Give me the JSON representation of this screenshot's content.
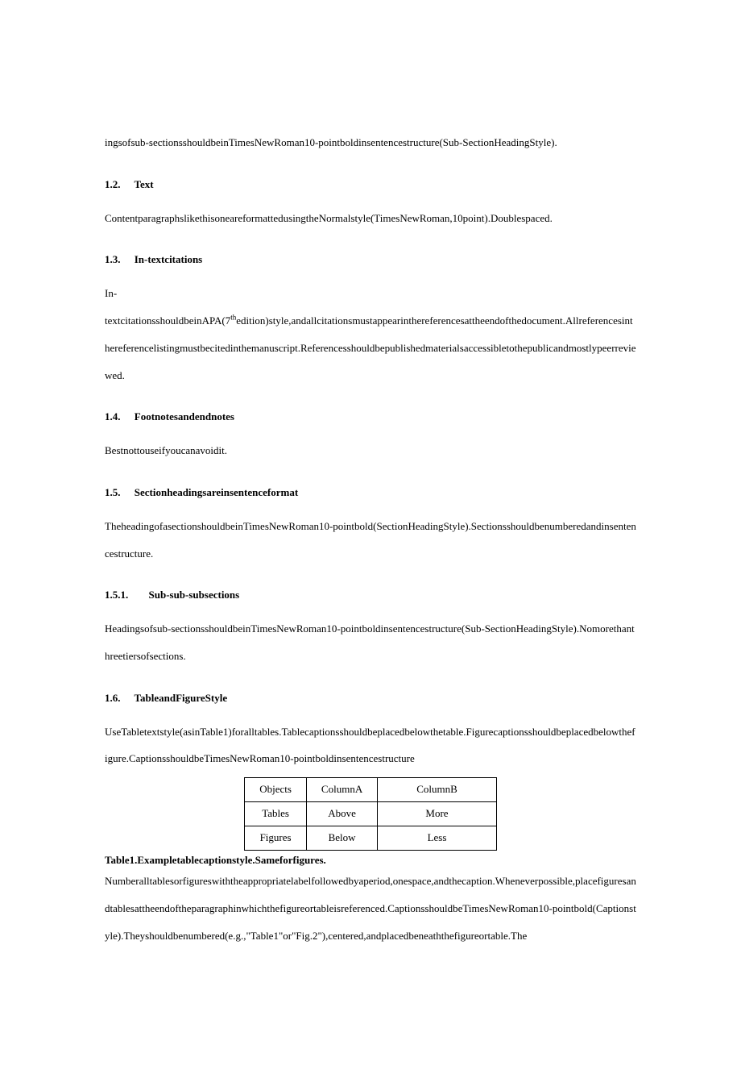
{
  "p0": "ingsofsub-sectionsshouldbeinTimesNewRoman10-pointboldinsentencestructure(Sub-SectionHeadingStyle).",
  "h12_num": "1.2.",
  "h12_title": "Text",
  "p12": "ContentparagraphslikethisoneareformattedusingtheNormalstyle(TimesNewRoman,10point).Doublespaced.",
  "h13_num": "1.3.",
  "h13_title": "In-textcitations",
  "p13a": "In-",
  "p13b_pre": "textcitationsshouldbeinAPA(7",
  "p13b_sup": "th",
  "p13b_post": "edition)style,andallcitationsmustappearinthereferencesattheendofthedocument.Allreferencesinthereferencelistingmustbecitedinthemanuscript.Referencesshouldbepublishedmaterialsaccessibletothepublicandmostlypeerreviewed.",
  "h14_num": "1.4.",
  "h14_title": "Footnotesandendnotes",
  "p14": "Bestnottouseifyoucanavoidit.",
  "h15_num": "1.5.",
  "h15_title": "Sectionheadingsareinsentenceformat",
  "p15": "TheheadingofasectionshouldbeinTimesNewRoman10-pointbold(SectionHeadingStyle).Sectionsshouldbenumberedandinsentencestructure.",
  "h151_num": "1.5.1.",
  "h151_title": "Sub-sub-subsections",
  "p151": "Headingsofsub-sectionsshouldbeinTimesNewRoman10-pointboldinsentencestructure(Sub-SectionHeadingStyle).Nomorethanthreetiersofsections.",
  "h16_num": "1.6.",
  "h16_title": "TableandFigureStyle",
  "p16": "UseTabletextstyle(asinTable1)foralltables.Tablecaptionsshouldbeplacedbelowthetable.Figurecaptionsshouldbeplacedbelowthefigure.CaptionsshouldbeTimesNewRoman10-pointboldinsentencestructure",
  "table": {
    "r0c0": "Objects",
    "r0c1": "ColumnA",
    "r0c2": "ColumnB",
    "r1c0": "Tables",
    "r1c1": "Above",
    "r1c2": "More",
    "r2c0": "Figures",
    "r2c1": "Below",
    "r2c2": "Less"
  },
  "caption": "Table1.Exampletablecaptionstyle.Sameforfigures.",
  "p_after_pre": "Numberalltablesorfigureswiththeappropriatelabelfollowedbyaperiod,onespace,andthecaption.Wheneverpossible,placefiguresandtablesattheendoftheparagraphinwhichthefigureortableisreferenced.CaptionsshouldbeTimesNewRoman10-pointbold(Captionstyle).Theyshouldbenumbered(e.g.,",
  "p_after_q1": "\"",
  "p_after_mid1": "Table1",
  "p_after_q2": "\"",
  "p_after_mid2": "or\"Fig.2\"),centered,andplacedbeneaththefigureortable.The"
}
